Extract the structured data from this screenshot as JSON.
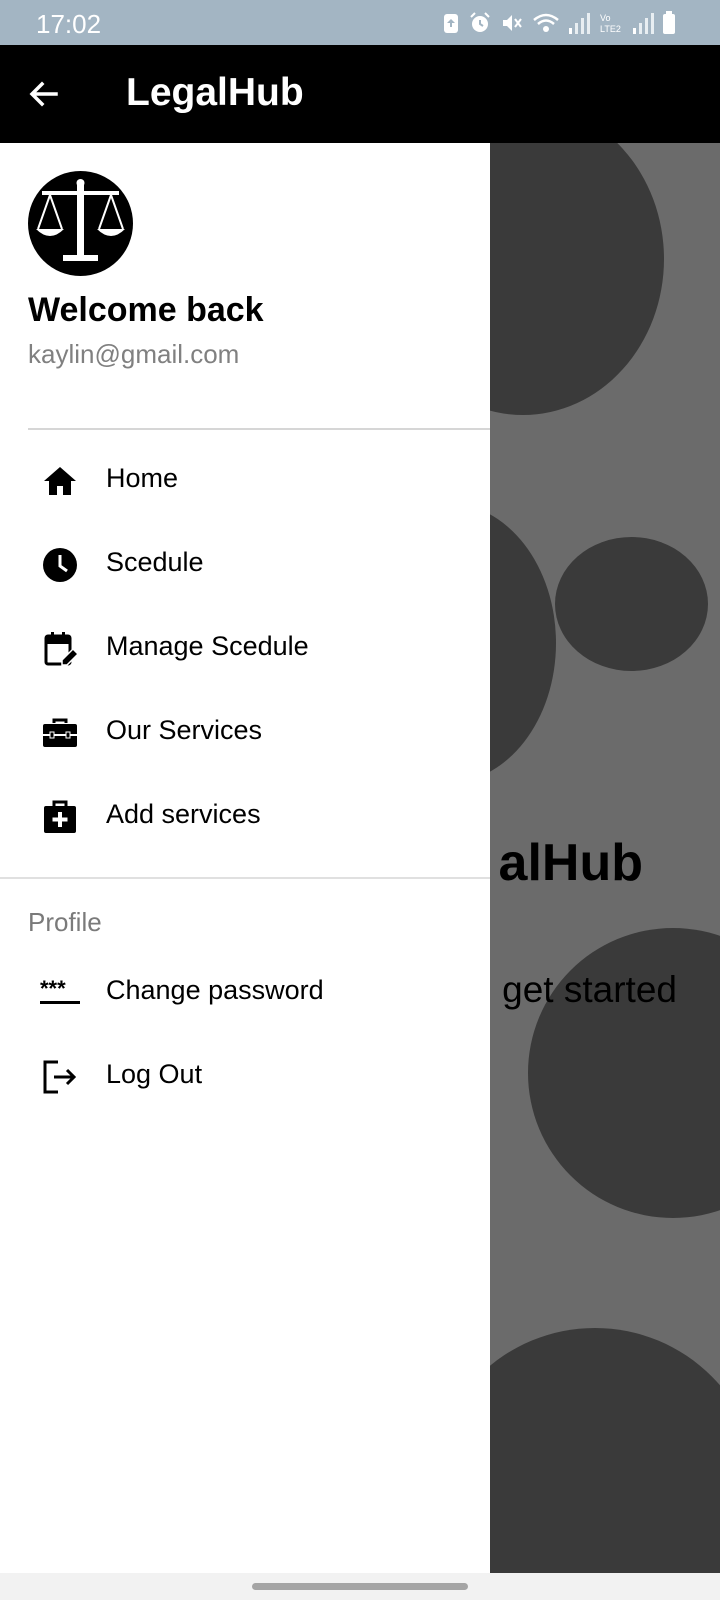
{
  "status_bar": {
    "time": "17:02",
    "icons": [
      "upload-icon",
      "alarm-icon",
      "mute-icon",
      "wifi-icon",
      "signal-icon",
      "volte-icon",
      "signal-icon",
      "battery-icon"
    ],
    "volte_text": "Vo\nLTE2"
  },
  "app_bar": {
    "title": "LegalHub",
    "back_icon": "arrow-back-icon"
  },
  "background": {
    "title_fragment": "alHub",
    "subtitle_fragment": "get started"
  },
  "drawer": {
    "header": {
      "avatar_icon": "scales-of-justice-icon",
      "welcome": "Welcome back",
      "email": "kaylin@gmail.com"
    },
    "menu": [
      {
        "label": "Home",
        "icon": "home-icon"
      },
      {
        "label": "Scedule",
        "icon": "clock-icon"
      },
      {
        "label": "Manage Scedule",
        "icon": "calendar-edit-icon"
      },
      {
        "label": "Our Services",
        "icon": "briefcase-icon"
      },
      {
        "label": "Add services",
        "icon": "medical-bag-add-icon"
      }
    ],
    "profile_section": {
      "label": "Profile",
      "items": [
        {
          "label": "Change password",
          "icon": "password-icon"
        },
        {
          "label": "Log Out",
          "icon": "logout-icon"
        }
      ]
    }
  },
  "colors": {
    "status_bar": "#a3b5c3",
    "app_bar": "#000000",
    "drawer": "#ffffff",
    "scrim": "#6b6b6b",
    "circle": "#3a3a3a"
  }
}
